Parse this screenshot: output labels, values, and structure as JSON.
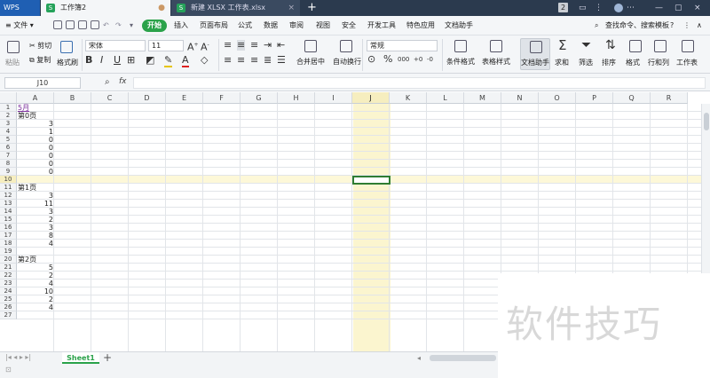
{
  "titlebar": {
    "app_tab": "WPS",
    "tabs": [
      {
        "label": "工作簿2",
        "active": true
      },
      {
        "label": "新建 XLSX 工作表.xlsx",
        "active": false
      }
    ],
    "new_tab": "+",
    "page_badge": "2"
  },
  "menubar": {
    "file": "文件",
    "items": [
      "开始",
      "插入",
      "页面布局",
      "公式",
      "数据",
      "审阅",
      "视图",
      "安全",
      "开发工具",
      "特色应用",
      "文档助手"
    ],
    "search": "查找命令、搜索模板",
    "help": "?"
  },
  "ribbon": {
    "paste": "粘贴",
    "cut": "剪切",
    "copy": "复制",
    "format_painter": "格式刷",
    "font_name": "宋体",
    "font_size": "11",
    "merge_center": "合并居中",
    "wrap_text": "自动换行",
    "number_format": "常规",
    "conditional_format": "条件格式",
    "table_style": "表格样式",
    "doc_assistant": "文档助手",
    "sum": "求和",
    "filter": "筛选",
    "sort": "排序",
    "format": "格式",
    "row_col": "行和列",
    "worksheet": "工作表"
  },
  "formula_bar": {
    "cell_ref": "J10",
    "fx": "fx",
    "value": ""
  },
  "grid": {
    "columns": [
      "A",
      "B",
      "C",
      "D",
      "E",
      "F",
      "G",
      "H",
      "I",
      "J",
      "K",
      "L",
      "M",
      "N",
      "O",
      "P",
      "Q",
      "R"
    ],
    "selected_column": "J",
    "selected_row": "10",
    "rows": [
      "1",
      "2",
      "3",
      "4",
      "5",
      "6",
      "7",
      "8",
      "9",
      "10",
      "11",
      "12",
      "13",
      "14",
      "15",
      "16",
      "17",
      "18",
      "19",
      "20",
      "21",
      "22",
      "23",
      "24",
      "25",
      "26",
      "27"
    ],
    "cells_a": [
      {
        "row": "1",
        "text": "5月",
        "type": "link"
      },
      {
        "row": "2",
        "text": "第0页",
        "type": "text"
      },
      {
        "row": "3",
        "text": "3",
        "type": "num"
      },
      {
        "row": "4",
        "text": "1",
        "type": "num"
      },
      {
        "row": "5",
        "text": "0",
        "type": "num"
      },
      {
        "row": "6",
        "text": "0",
        "type": "num"
      },
      {
        "row": "7",
        "text": "0",
        "type": "num"
      },
      {
        "row": "8",
        "text": "0",
        "type": "num"
      },
      {
        "row": "9",
        "text": "0",
        "type": "num"
      },
      {
        "row": "11",
        "text": "第1页",
        "type": "text"
      },
      {
        "row": "12",
        "text": "3",
        "type": "num"
      },
      {
        "row": "13",
        "text": "11",
        "type": "num"
      },
      {
        "row": "14",
        "text": "3",
        "type": "num"
      },
      {
        "row": "15",
        "text": "2",
        "type": "num"
      },
      {
        "row": "16",
        "text": "3",
        "type": "num"
      },
      {
        "row": "17",
        "text": "8",
        "type": "num"
      },
      {
        "row": "18",
        "text": "4",
        "type": "num"
      },
      {
        "row": "20",
        "text": "第2页",
        "type": "text"
      },
      {
        "row": "21",
        "text": "5",
        "type": "num"
      },
      {
        "row": "22",
        "text": "2",
        "type": "num"
      },
      {
        "row": "23",
        "text": "4",
        "type": "num"
      },
      {
        "row": "24",
        "text": "10",
        "type": "num"
      },
      {
        "row": "25",
        "text": "2",
        "type": "num"
      },
      {
        "row": "26",
        "text": "4",
        "type": "num"
      }
    ]
  },
  "sheets": {
    "tabs": [
      "Sheet1"
    ],
    "add": "+"
  },
  "watermark": "软件技巧"
}
